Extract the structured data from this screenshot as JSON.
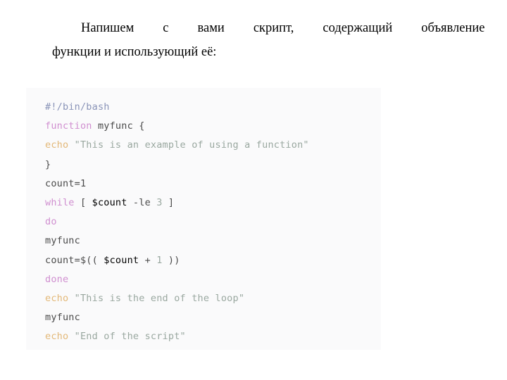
{
  "document": {
    "paragraph": {
      "line1_words": [
        "Напишем",
        "с",
        "вами",
        "скрипт,",
        "содержащий",
        "объявление"
      ],
      "line2": "функции и использующий её:",
      "full_text": "Напишем с вами скрипт, содержащий объявление функции и использующий её:"
    },
    "code_block": {
      "language": "bash",
      "background_color": "#fafafb",
      "token_colors": {
        "plain": "#4a4a4a",
        "comment": "#8a94b8",
        "keyword": "#d08fd0",
        "builtin": "#e3b878",
        "string": "#9aa8a0",
        "variable": "#e3c27a"
      },
      "plain_text": "#!/bin/bash\nfunction myfunc {\necho \"This is an example of using a function\"\n}\ncount=1\nwhile [ $count -le 3 ]\ndo\nmyfunc\ncount=$(( $count + 1 ))\ndone\necho \"This is the end of the loop\"\nmyfunc\necho \"End of the script\"",
      "lines": [
        {
          "id": "shebang",
          "tokens": [
            {
              "t": "#!/bin/bash",
              "c": "comment"
            }
          ]
        },
        {
          "id": "func-decl",
          "tokens": [
            {
              "t": "function",
              "c": "keyword"
            },
            {
              "t": " myfunc {",
              "c": "plain"
            }
          ]
        },
        {
          "id": "echo-example",
          "tokens": [
            {
              "t": "echo",
              "c": "builtin"
            },
            {
              "t": " ",
              "c": "plain"
            },
            {
              "t": "\"This is an example of using a function\"",
              "c": "string"
            }
          ]
        },
        {
          "id": "func-close",
          "tokens": [
            {
              "t": "}",
              "c": "plain"
            }
          ]
        },
        {
          "id": "count-init",
          "tokens": [
            {
              "t": "count=1",
              "c": "plain"
            }
          ]
        },
        {
          "id": "while-cond",
          "tokens": [
            {
              "t": "while",
              "c": "keyword"
            },
            {
              "t": " [ ",
              "c": "plain"
            },
            {
              "t": "$count",
              "c": "variable"
            },
            {
              "t": " -le ",
              "c": "plain"
            },
            {
              "t": "3",
              "c": "string"
            },
            {
              "t": " ]",
              "c": "plain"
            }
          ]
        },
        {
          "id": "do",
          "tokens": [
            {
              "t": "do",
              "c": "keyword"
            }
          ]
        },
        {
          "id": "call-myfunc-1",
          "tokens": [
            {
              "t": "myfunc",
              "c": "plain"
            }
          ]
        },
        {
          "id": "count-incr",
          "tokens": [
            {
              "t": "count=$(( ",
              "c": "plain"
            },
            {
              "t": "$count",
              "c": "variable"
            },
            {
              "t": " + ",
              "c": "plain"
            },
            {
              "t": "1",
              "c": "string"
            },
            {
              "t": " ))",
              "c": "plain"
            }
          ]
        },
        {
          "id": "done",
          "tokens": [
            {
              "t": "done",
              "c": "keyword"
            }
          ]
        },
        {
          "id": "echo-endloop",
          "tokens": [
            {
              "t": "echo",
              "c": "builtin"
            },
            {
              "t": " ",
              "c": "plain"
            },
            {
              "t": "\"This is the end of the loop\"",
              "c": "string"
            }
          ]
        },
        {
          "id": "call-myfunc-2",
          "tokens": [
            {
              "t": "myfunc",
              "c": "plain"
            }
          ]
        },
        {
          "id": "echo-endscript",
          "tokens": [
            {
              "t": "echo",
              "c": "builtin"
            },
            {
              "t": " ",
              "c": "plain"
            },
            {
              "t": "\"End of the script\"",
              "c": "string"
            }
          ]
        }
      ]
    }
  }
}
